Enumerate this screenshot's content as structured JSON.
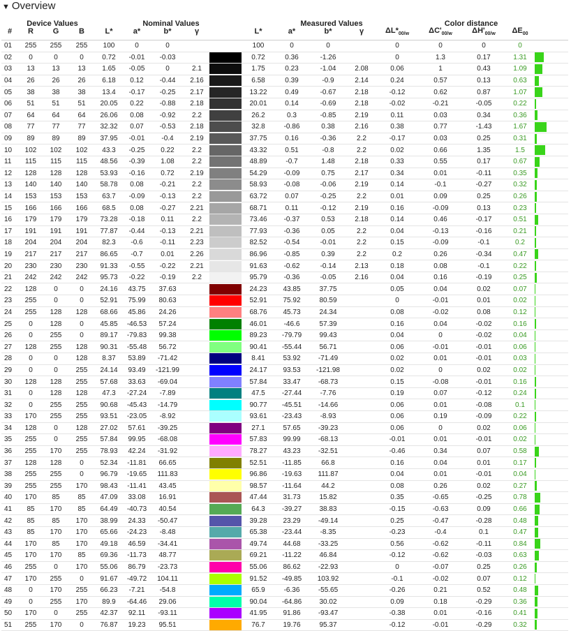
{
  "title": "Overview",
  "groups": {
    "device": "Device Values",
    "nominal": "Nominal Values",
    "measured": "Measured Values",
    "distance": "Color distance"
  },
  "cols": {
    "idx": "#",
    "r": "R",
    "g": "G",
    "b": "B",
    "L": "L*",
    "a": "a*",
    "bb": "b*",
    "gamma": "γ",
    "dL": "ΔL*",
    "dC": "ΔC'",
    "dH": "ΔH'",
    "dE": "ΔE",
    "sub_w": "00/w",
    "sub_00": "00"
  },
  "rows": [
    [
      "01",
      "255",
      "255",
      "255",
      "100",
      "0",
      "0",
      "",
      "#ffffff",
      "100",
      "0",
      "0",
      "",
      "0",
      "0",
      "0",
      "0"
    ],
    [
      "02",
      "0",
      "0",
      "0",
      "0.72",
      "-0.01",
      "-0.03",
      "",
      "#000000",
      "0.72",
      "0.36",
      "-1.26",
      "",
      "0",
      "1.3",
      "0.17",
      "1.31"
    ],
    [
      "03",
      "13",
      "13",
      "13",
      "1.65",
      "-0.05",
      "0",
      "2.1",
      "#0d0d0d",
      "1.75",
      "0.23",
      "-1.04",
      "2.08",
      "0.06",
      "1",
      "0.43",
      "1.09"
    ],
    [
      "04",
      "26",
      "26",
      "26",
      "6.18",
      "0.12",
      "-0.44",
      "2.16",
      "#1a1a1a",
      "6.58",
      "0.39",
      "-0.9",
      "2.14",
      "0.24",
      "0.57",
      "0.13",
      "0.63"
    ],
    [
      "05",
      "38",
      "38",
      "38",
      "13.4",
      "-0.17",
      "-0.25",
      "2.17",
      "#262626",
      "13.22",
      "0.49",
      "-0.67",
      "2.18",
      "-0.12",
      "0.62",
      "0.87",
      "1.07"
    ],
    [
      "06",
      "51",
      "51",
      "51",
      "20.05",
      "0.22",
      "-0.88",
      "2.18",
      "#333333",
      "20.01",
      "0.14",
      "-0.69",
      "2.18",
      "-0.02",
      "-0.21",
      "-0.05",
      "0.22"
    ],
    [
      "07",
      "64",
      "64",
      "64",
      "26.06",
      "0.08",
      "-0.92",
      "2.2",
      "#404040",
      "26.2",
      "0.3",
      "-0.85",
      "2.19",
      "0.11",
      "0.03",
      "0.34",
      "0.36"
    ],
    [
      "08",
      "77",
      "77",
      "77",
      "32.32",
      "0.07",
      "-0.53",
      "2.18",
      "#4d4d4d",
      "32.8",
      "-0.86",
      "0.38",
      "2.16",
      "0.38",
      "0.77",
      "-1.43",
      "1.67"
    ],
    [
      "09",
      "89",
      "89",
      "89",
      "37.95",
      "-0.01",
      "-0.4",
      "2.19",
      "#595959",
      "37.75",
      "0.16",
      "-0.36",
      "2.2",
      "-0.17",
      "0.03",
      "0.25",
      "0.31"
    ],
    [
      "10",
      "102",
      "102",
      "102",
      "43.3",
      "-0.25",
      "0.22",
      "2.2",
      "#666666",
      "43.32",
      "0.51",
      "-0.8",
      "2.2",
      "0.02",
      "0.66",
      "1.35",
      "1.5"
    ],
    [
      "11",
      "115",
      "115",
      "115",
      "48.56",
      "-0.39",
      "1.08",
      "2.2",
      "#737373",
      "48.89",
      "-0.7",
      "1.48",
      "2.18",
      "0.33",
      "0.55",
      "0.17",
      "0.67"
    ],
    [
      "12",
      "128",
      "128",
      "128",
      "53.93",
      "-0.16",
      "0.72",
      "2.19",
      "#808080",
      "54.29",
      "-0.09",
      "0.75",
      "2.17",
      "0.34",
      "0.01",
      "-0.11",
      "0.35"
    ],
    [
      "13",
      "140",
      "140",
      "140",
      "58.78",
      "0.08",
      "-0.21",
      "2.2",
      "#8c8c8c",
      "58.93",
      "-0.08",
      "-0.06",
      "2.19",
      "0.14",
      "-0.1",
      "-0.27",
      "0.32"
    ],
    [
      "14",
      "153",
      "153",
      "153",
      "63.7",
      "-0.09",
      "-0.13",
      "2.2",
      "#999999",
      "63.72",
      "0.07",
      "-0.25",
      "2.2",
      "0.01",
      "0.09",
      "0.25",
      "0.26"
    ],
    [
      "15",
      "166",
      "166",
      "166",
      "68.5",
      "0.08",
      "-0.27",
      "2.21",
      "#a6a6a6",
      "68.71",
      "0.11",
      "-0.12",
      "2.19",
      "0.16",
      "-0.09",
      "0.13",
      "0.23"
    ],
    [
      "16",
      "179",
      "179",
      "179",
      "73.28",
      "-0.18",
      "0.11",
      "2.2",
      "#b3b3b3",
      "73.46",
      "-0.37",
      "0.53",
      "2.18",
      "0.14",
      "0.46",
      "-0.17",
      "0.51"
    ],
    [
      "17",
      "191",
      "191",
      "191",
      "77.87",
      "-0.44",
      "-0.13",
      "2.21",
      "#bfbfbf",
      "77.93",
      "-0.36",
      "0.05",
      "2.2",
      "0.04",
      "-0.13",
      "-0.16",
      "0.21"
    ],
    [
      "18",
      "204",
      "204",
      "204",
      "82.3",
      "-0.6",
      "-0.11",
      "2.23",
      "#cccccc",
      "82.52",
      "-0.54",
      "-0.01",
      "2.2",
      "0.15",
      "-0.09",
      "-0.1",
      "0.2"
    ],
    [
      "19",
      "217",
      "217",
      "217",
      "86.65",
      "-0.7",
      "0.01",
      "2.26",
      "#d9d9d9",
      "86.96",
      "-0.85",
      "0.39",
      "2.2",
      "0.2",
      "0.26",
      "-0.34",
      "0.47"
    ],
    [
      "20",
      "230",
      "230",
      "230",
      "91.33",
      "-0.55",
      "-0.22",
      "2.21",
      "#e6e6e6",
      "91.63",
      "-0.62",
      "-0.14",
      "2.13",
      "0.18",
      "0.08",
      "-0.1",
      "0.22"
    ],
    [
      "21",
      "242",
      "242",
      "242",
      "95.73",
      "-0.22",
      "-0.19",
      "2.2",
      "#f2f2f2",
      "95.79",
      "-0.36",
      "-0.05",
      "2.16",
      "0.04",
      "0.16",
      "-0.19",
      "0.25"
    ],
    [
      "22",
      "128",
      "0",
      "0",
      "24.16",
      "43.75",
      "37.63",
      "",
      "#800000",
      "24.23",
      "43.85",
      "37.75",
      "",
      "0.05",
      "0.04",
      "0.02",
      "0.07"
    ],
    [
      "23",
      "255",
      "0",
      "0",
      "52.91",
      "75.99",
      "80.63",
      "",
      "#ff0000",
      "52.91",
      "75.92",
      "80.59",
      "",
      "0",
      "-0.01",
      "0.01",
      "0.02"
    ],
    [
      "24",
      "255",
      "128",
      "128",
      "68.66",
      "45.86",
      "24.26",
      "",
      "#ff8080",
      "68.76",
      "45.73",
      "24.34",
      "",
      "0.08",
      "-0.02",
      "0.08",
      "0.12"
    ],
    [
      "25",
      "0",
      "128",
      "0",
      "45.85",
      "-46.53",
      "57.24",
      "",
      "#008000",
      "46.01",
      "-46.6",
      "57.39",
      "",
      "0.16",
      "0.04",
      "-0.02",
      "0.16"
    ],
    [
      "26",
      "0",
      "255",
      "0",
      "89.17",
      "-79.83",
      "99.38",
      "",
      "#00ff00",
      "89.23",
      "-79.79",
      "99.43",
      "",
      "0.04",
      "0",
      "-0.02",
      "0.04"
    ],
    [
      "27",
      "128",
      "255",
      "128",
      "90.31",
      "-55.48",
      "56.72",
      "",
      "#80ff80",
      "90.41",
      "-55.44",
      "56.71",
      "",
      "0.06",
      "-0.01",
      "-0.01",
      "0.06"
    ],
    [
      "28",
      "0",
      "0",
      "128",
      "8.37",
      "53.89",
      "-71.42",
      "",
      "#000080",
      "8.41",
      "53.92",
      "-71.49",
      "",
      "0.02",
      "0.01",
      "-0.01",
      "0.03"
    ],
    [
      "29",
      "0",
      "0",
      "255",
      "24.14",
      "93.49",
      "-121.99",
      "",
      "#0000ff",
      "24.17",
      "93.53",
      "-121.98",
      "",
      "0.02",
      "0",
      "0.02",
      "0.02"
    ],
    [
      "30",
      "128",
      "128",
      "255",
      "57.68",
      "33.63",
      "-69.04",
      "",
      "#8080ff",
      "57.84",
      "33.47",
      "-68.73",
      "",
      "0.15",
      "-0.08",
      "-0.01",
      "0.16"
    ],
    [
      "31",
      "0",
      "128",
      "128",
      "47.3",
      "-27.24",
      "-7.89",
      "",
      "#008080",
      "47.5",
      "-27.44",
      "-7.76",
      "",
      "0.19",
      "0.07",
      "-0.12",
      "0.24"
    ],
    [
      "32",
      "0",
      "255",
      "255",
      "90.68",
      "-45.43",
      "-14.79",
      "",
      "#00ffff",
      "90.77",
      "-45.51",
      "-14.66",
      "",
      "0.06",
      "0.01",
      "-0.08",
      "0.1"
    ],
    [
      "33",
      "170",
      "255",
      "255",
      "93.51",
      "-23.05",
      "-8.92",
      "",
      "#aaffff",
      "93.61",
      "-23.43",
      "-8.93",
      "",
      "0.06",
      "0.19",
      "-0.09",
      "0.22"
    ],
    [
      "34",
      "128",
      "0",
      "128",
      "27.02",
      "57.61",
      "-39.25",
      "",
      "#800080",
      "27.1",
      "57.65",
      "-39.23",
      "",
      "0.06",
      "0",
      "0.02",
      "0.06"
    ],
    [
      "35",
      "255",
      "0",
      "255",
      "57.84",
      "99.95",
      "-68.08",
      "",
      "#ff00ff",
      "57.83",
      "99.99",
      "-68.13",
      "",
      "-0.01",
      "0.01",
      "-0.01",
      "0.02"
    ],
    [
      "36",
      "255",
      "170",
      "255",
      "78.93",
      "42.24",
      "-31.92",
      "",
      "#ffaaff",
      "78.27",
      "43.23",
      "-32.51",
      "",
      "-0.46",
      "0.34",
      "0.07",
      "0.58"
    ],
    [
      "37",
      "128",
      "128",
      "0",
      "52.34",
      "-11.81",
      "66.65",
      "",
      "#808000",
      "52.51",
      "-11.85",
      "66.8",
      "",
      "0.16",
      "0.04",
      "0.01",
      "0.17"
    ],
    [
      "38",
      "255",
      "255",
      "0",
      "96.79",
      "-19.65",
      "111.83",
      "",
      "#ffff00",
      "96.86",
      "-19.63",
      "111.87",
      "",
      "0.04",
      "0.01",
      "-0.01",
      "0.04"
    ],
    [
      "39",
      "255",
      "255",
      "170",
      "98.43",
      "-11.41",
      "43.45",
      "",
      "#ffffaa",
      "98.57",
      "-11.64",
      "44.2",
      "",
      "0.08",
      "0.26",
      "0.02",
      "0.27"
    ],
    [
      "40",
      "170",
      "85",
      "85",
      "47.09",
      "33.08",
      "16.91",
      "",
      "#aa5555",
      "47.44",
      "31.73",
      "15.82",
      "",
      "0.35",
      "-0.65",
      "-0.25",
      "0.78"
    ],
    [
      "41",
      "85",
      "170",
      "85",
      "64.49",
      "-40.73",
      "40.54",
      "",
      "#55aa55",
      "64.3",
      "-39.27",
      "38.83",
      "",
      "-0.15",
      "-0.63",
      "0.09",
      "0.66"
    ],
    [
      "42",
      "85",
      "85",
      "170",
      "38.99",
      "24.33",
      "-50.47",
      "",
      "#5555aa",
      "39.28",
      "23.29",
      "-49.14",
      "",
      "0.25",
      "-0.47",
      "-0.28",
      "0.48"
    ],
    [
      "43",
      "85",
      "170",
      "170",
      "65.66",
      "-24.23",
      "-8.48",
      "",
      "#55aaaa",
      "65.38",
      "-23.44",
      "-8.35",
      "",
      "-0.23",
      "-0.4",
      "0.1",
      "0.47"
    ],
    [
      "44",
      "170",
      "85",
      "170",
      "49.18",
      "46.59",
      "-34.41",
      "",
      "#aa55aa",
      "49.74",
      "44.68",
      "-33.25",
      "",
      "0.56",
      "-0.62",
      "-0.11",
      "0.84"
    ],
    [
      "45",
      "170",
      "170",
      "85",
      "69.36",
      "-11.73",
      "48.77",
      "",
      "#aaaa55",
      "69.21",
      "-11.22",
      "46.84",
      "",
      "-0.12",
      "-0.62",
      "-0.03",
      "0.63"
    ],
    [
      "46",
      "255",
      "0",
      "170",
      "55.06",
      "86.79",
      "-23.73",
      "",
      "#ff00aa",
      "55.06",
      "86.62",
      "-22.93",
      "",
      "0",
      "-0.07",
      "0.25",
      "0.26"
    ],
    [
      "47",
      "170",
      "255",
      "0",
      "91.67",
      "-49.72",
      "104.11",
      "",
      "#aaff00",
      "91.52",
      "-49.85",
      "103.92",
      "",
      "-0.1",
      "-0.02",
      "0.07",
      "0.12"
    ],
    [
      "48",
      "0",
      "170",
      "255",
      "66.23",
      "-7.21",
      "-54.8",
      "",
      "#00aaff",
      "65.9",
      "-6.36",
      "-55.65",
      "",
      "-0.26",
      "0.21",
      "0.52",
      "0.48"
    ],
    [
      "49",
      "0",
      "255",
      "170",
      "89.9",
      "-64.46",
      "29.06",
      "",
      "#00ffaa",
      "90.04",
      "-64.86",
      "30.02",
      "",
      "0.09",
      "0.18",
      "-0.29",
      "0.36"
    ],
    [
      "50",
      "170",
      "0",
      "255",
      "42.37",
      "92.11",
      "-93.11",
      "",
      "#aa00ff",
      "41.95",
      "91.86",
      "-93.47",
      "",
      "-0.38",
      "0.01",
      "-0.16",
      "0.41"
    ],
    [
      "51",
      "255",
      "170",
      "0",
      "76.87",
      "19.23",
      "95.51",
      "",
      "#ffaa00",
      "76.7",
      "19.76",
      "95.37",
      "",
      "-0.12",
      "-0.01",
      "-0.29",
      "0.32"
    ]
  ]
}
